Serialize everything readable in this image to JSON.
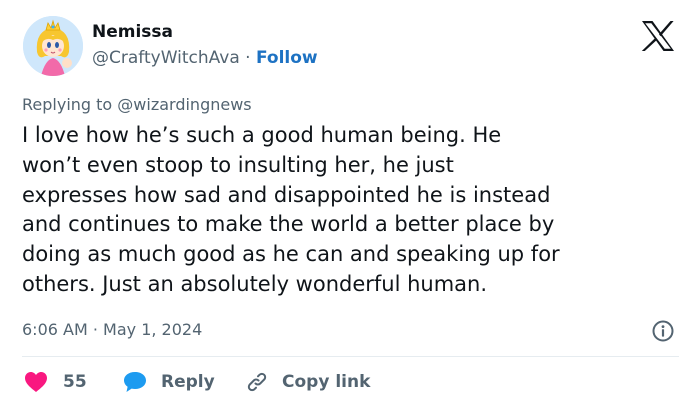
{
  "author": {
    "name": "Nemissa",
    "handle": "@CraftyWitchAva",
    "separator": "·",
    "follow_label": "Follow"
  },
  "reply_context": {
    "prefix": "Replying to",
    "mention": "@wizardingnews"
  },
  "tweet": {
    "lines": [
      "I love how he’s such a good human being. He",
      "won’t even stoop to insulting her, he just",
      "expresses how sad and disappointed he is instead",
      "and continues to make the world a better place by",
      "doing as much good as he can and speaking up for",
      "others. Just an absolutely wonderful human."
    ],
    "timestamp": "6:06 AM · May 1, 2024"
  },
  "actions": {
    "like_count": "55",
    "reply_label": "Reply",
    "copy_link_label": "Copy link"
  },
  "icons": {
    "brand": "x-logo-icon",
    "info": "info-icon",
    "like": "heart-icon",
    "reply": "speech-bubble-icon",
    "copy": "link-icon"
  },
  "colors": {
    "text": "#0f1419",
    "secondary_text": "#536471",
    "link": "#1d72c3",
    "like": "#f91880",
    "reply": "#1d9bf0",
    "divider": "#e6ecf0"
  }
}
